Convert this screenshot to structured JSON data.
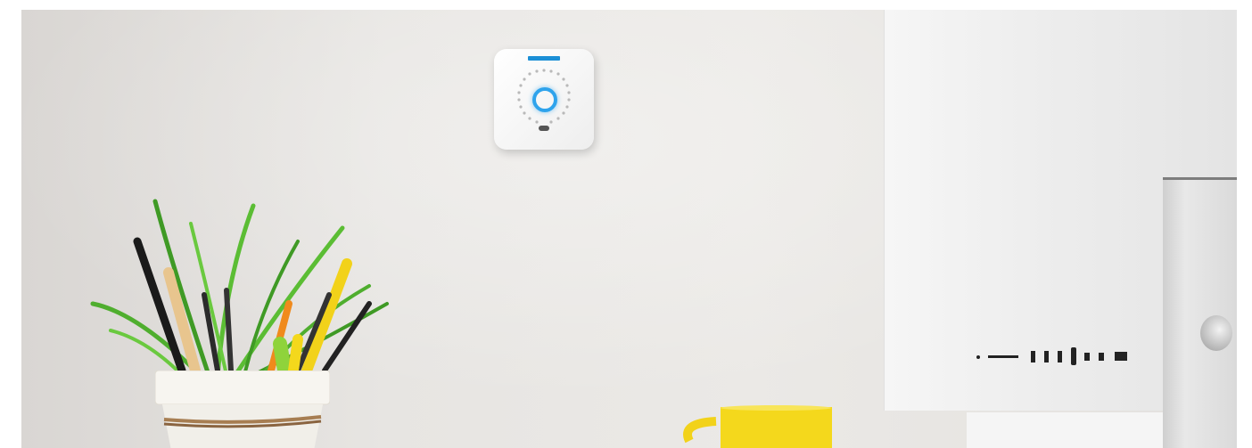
{
  "scene": {
    "description_tags": [
      "wall",
      "thermostat",
      "plant-pot",
      "pencils",
      "yellow-mug",
      "imac"
    ],
    "colors": {
      "wall": "#e7e5e2",
      "thermostat_ring": "#2ea3ec",
      "brand": "#1b8fd6",
      "mug": "#f4d81c",
      "pot": "#f7f5f0",
      "foliage": "#4fae2e"
    }
  }
}
